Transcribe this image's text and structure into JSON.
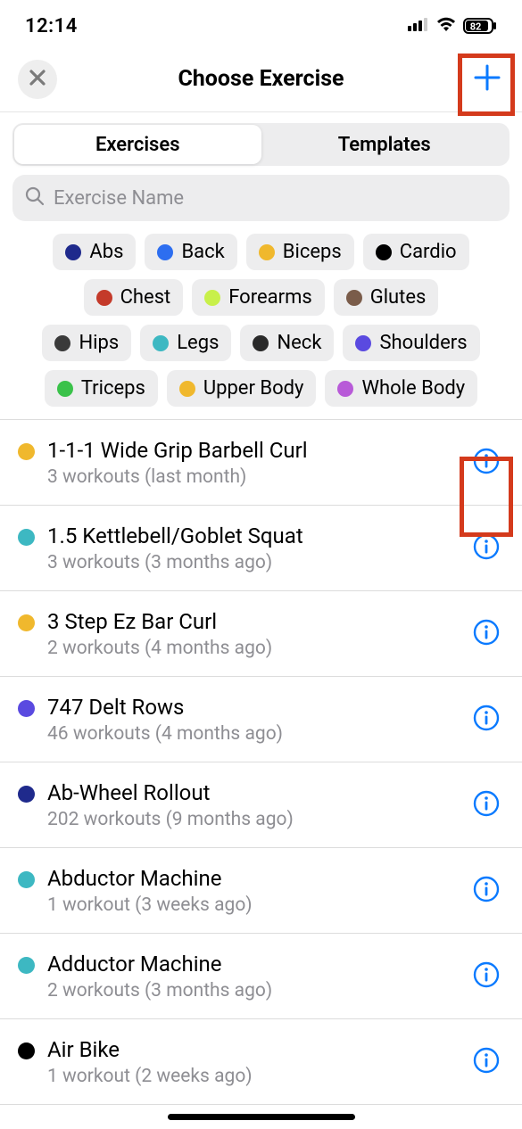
{
  "status": {
    "time": "12:14",
    "battery": "82"
  },
  "nav": {
    "title": "Choose Exercise"
  },
  "tabs": {
    "active": "Exercises",
    "other": "Templates"
  },
  "search": {
    "placeholder": "Exercise Name"
  },
  "filters": [
    {
      "label": "Abs",
      "color": "#1f2a8c"
    },
    {
      "label": "Back",
      "color": "#2d6ef0"
    },
    {
      "label": "Biceps",
      "color": "#f0b82d"
    },
    {
      "label": "Cardio",
      "color": "#000000"
    },
    {
      "label": "Chest",
      "color": "#c43a2a"
    },
    {
      "label": "Forearms",
      "color": "#c8f04a"
    },
    {
      "label": "Glutes",
      "color": "#7a5c4a"
    },
    {
      "label": "Hips",
      "color": "#3a3a3a"
    },
    {
      "label": "Legs",
      "color": "#3db8c2"
    },
    {
      "label": "Neck",
      "color": "#2a2a2a"
    },
    {
      "label": "Shoulders",
      "color": "#5a4ae0"
    },
    {
      "label": "Triceps",
      "color": "#3ac24a"
    },
    {
      "label": "Upper Body",
      "color": "#f0b82d"
    },
    {
      "label": "Whole Body",
      "color": "#b85ad8"
    }
  ],
  "exercises": [
    {
      "color": "#f0b82d",
      "name": "1-1-1 Wide Grip Barbell Curl",
      "sub": "3 workouts (last month)"
    },
    {
      "color": "#3db8c2",
      "name": "1.5 Kettlebell/Goblet Squat",
      "sub": "3 workouts (3 months ago)"
    },
    {
      "color": "#f0b82d",
      "name": "3 Step Ez Bar Curl",
      "sub": "2 workouts (4 months ago)"
    },
    {
      "color": "#5a4ae0",
      "name": "747 Delt Rows",
      "sub": "46 workouts (4 months ago)"
    },
    {
      "color": "#1f2a8c",
      "name": "Ab-Wheel Rollout",
      "sub": "202 workouts (9 months ago)"
    },
    {
      "color": "#3db8c2",
      "name": "Abductor Machine",
      "sub": "1 workout (3 weeks ago)"
    },
    {
      "color": "#3db8c2",
      "name": "Adductor Machine",
      "sub": "2 workouts (3 months ago)"
    },
    {
      "color": "#000000",
      "name": "Air Bike",
      "sub": "1 workout (2 weeks ago)"
    }
  ]
}
